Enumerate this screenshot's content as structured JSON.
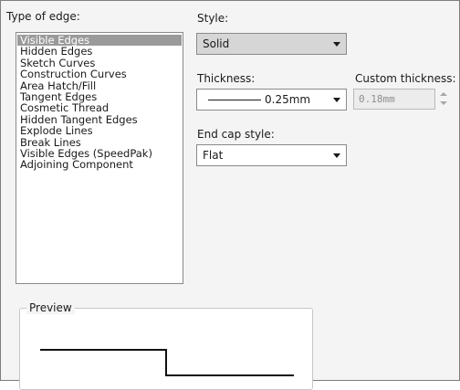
{
  "type_of_edge": {
    "label": "Type of edge:",
    "selected": "Visible Edges",
    "items": [
      "Visible Edges",
      "Hidden Edges",
      "Sketch Curves",
      "Construction Curves",
      "Area Hatch/Fill",
      "Tangent Edges",
      "Cosmetic Thread",
      "Hidden Tangent Edges",
      "Explode Lines",
      "Break Lines",
      "Visible Edges (SpeedPak)",
      "Adjoining Component"
    ]
  },
  "style": {
    "label": "Style:",
    "value": "Solid"
  },
  "thickness": {
    "label": "Thickness:",
    "value": "0.25mm"
  },
  "custom_thickness": {
    "label": "Custom thickness:",
    "value": "0.18mm"
  },
  "end_cap": {
    "label": "End cap style:",
    "value": "Flat"
  },
  "preview": {
    "label": "Preview"
  },
  "colors": {
    "selection": "#9a9a9a",
    "panel": "#f4f4f4",
    "disabled_text": "#8e8e8e"
  }
}
